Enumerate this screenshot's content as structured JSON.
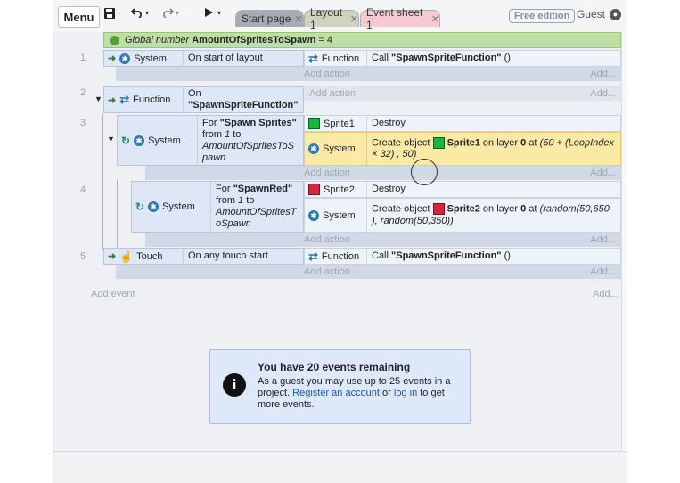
{
  "toolbar": {
    "menu_label": "Menu",
    "save_icon": "save-icon",
    "undo_icon": "undo-icon",
    "redo_icon": "redo-icon",
    "play_icon": "play-icon",
    "tabs": [
      {
        "label": "Start page"
      },
      {
        "label": "Layout 1"
      },
      {
        "label": "Event sheet 1"
      }
    ],
    "free_edition": "Free edition",
    "guest": "Guest"
  },
  "global_var": {
    "prefix": "Global number",
    "name": "AmountOfSpritesToSpawn",
    "suffix": "= 4"
  },
  "events": [
    {
      "number": "1",
      "condition_object": "System",
      "condition_text": "On start of layout",
      "action_object": "Function",
      "action_text_prefix": "Call",
      "action_text_bold": "\"SpawnSpriteFunction\"",
      "action_text_suffix": "()",
      "add_action": "Add action",
      "add_right": "Add..."
    },
    {
      "number": "2",
      "condition_object": "Function",
      "condition_line1": "On",
      "condition_line2": "\"SpawnSpriteFunction\"",
      "add_action": "Add action",
      "add_right": "Add..."
    },
    {
      "number": "3",
      "condition_object": "System",
      "for_prefix": "For",
      "for_name": "\"Spawn Sprites\"",
      "from_word": "from",
      "from_val": "1",
      "to_word": "to",
      "to_val_1": "AmountOfSpritesToS",
      "to_val_2": "pawn",
      "action1_object": "Sprite1",
      "action1_text": "Destroy",
      "action2_object": "System",
      "action2_prefix": "Create object",
      "action2_sprite": "Sprite1",
      "action2_middle": "on layer",
      "action2_layer": "0",
      "action2_at": "at",
      "action2_expr1": "(50 + (LoopIndex",
      "action2_expr2": "× 32) , 50)",
      "add_action": "Add action",
      "add_right": "Add..."
    },
    {
      "number": "4",
      "condition_object": "System",
      "for_prefix": "For",
      "for_name": "\"SpawnRed\"",
      "from_word": "from",
      "from_val": "1",
      "to_word": "to",
      "to_val_1": "AmountOfSpritesT",
      "to_val_2": "oSpawn",
      "action1_object": "Sprite2",
      "action1_text": "Destroy",
      "action2_object": "System",
      "action2_prefix": "Create object",
      "action2_sprite": "Sprite2",
      "action2_middle": "on layer",
      "action2_layer": "0",
      "action2_at": "at",
      "action2_expr1": "(random(50,650",
      "action2_expr2": "), random(50,350))",
      "add_action": "Add action",
      "add_right": "Add..."
    },
    {
      "number": "5",
      "condition_object": "Touch",
      "condition_text": "On any touch start",
      "action_object": "Function",
      "action_text_prefix": "Call",
      "action_text_bold": "\"SpawnSpriteFunction\"",
      "action_text_suffix": "()",
      "add_action": "Add action",
      "add_right": "Add..."
    }
  ],
  "add_event": "Add event",
  "add_event_right": "Add...",
  "notice": {
    "title": "You have 20 events remaining",
    "line1": "As a guest you may use up to 25 events in a project.",
    "register": "Register an account",
    "or": "or",
    "login": "log in",
    "tail": "to get more events."
  },
  "colors": {
    "sprite1": "#17b83a",
    "sprite2": "#d8243d",
    "global_bg": "#bfe0a4",
    "highlight": "#fbe9a6"
  }
}
